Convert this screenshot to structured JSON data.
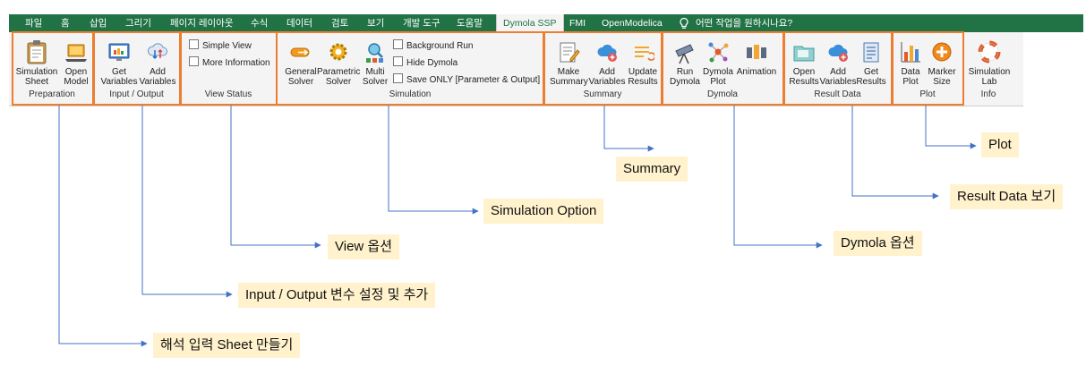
{
  "tabs": [
    "파일",
    "홈",
    "삽입",
    "그리기",
    "페이지 레이아웃",
    "수식",
    "데이터",
    "검토",
    "보기",
    "개발 도구",
    "도움말",
    "Dymola SSP",
    "FMI",
    "OpenModelica",
    "어떤 작업을 원하시나요?"
  ],
  "ribbon": {
    "preparation": {
      "label": "Preparation",
      "simulation_sheet": "Simulation\nSheet",
      "open_model": "Open\nModel"
    },
    "io": {
      "label": "Input / Output",
      "get_variables": "Get\nVariables",
      "add_variables": "Add\nVariables"
    },
    "view_status": {
      "label": "View Status",
      "simple_view": "Simple View",
      "more_information": "More Information"
    },
    "simulation": {
      "label": "Simulation",
      "general_solver": "General\nSolver",
      "parametric_solver": "Parametric\nSolver",
      "multi_solver": "Multi\nSolver",
      "background_run": "Background Run",
      "hide_dymola": "Hide Dymola",
      "save_only": "Save ONLY [Parameter & Output]"
    },
    "summary": {
      "label": "Summary",
      "make_summary": "Make\nSummary",
      "add_variables": "Add\nVariables",
      "update_results": "Update\nResults"
    },
    "dymola": {
      "label": "Dymola",
      "run_dymola": "Run\nDymola",
      "dymola_plot": "Dymola\nPlot",
      "animation": "Animation"
    },
    "result_data": {
      "label": "Result Data",
      "open_results": "Open\nResults",
      "add_variables": "Add\nVariables",
      "get_results": "Get\nResults"
    },
    "plot": {
      "label": "Plot",
      "data_plot": "Data\nPlot",
      "marker_size": "Marker\nSize"
    },
    "info": {
      "label": "Info",
      "simulation_lab": "Simulation\nLab"
    }
  },
  "callouts": {
    "plot": "Plot",
    "summary": "Summary",
    "result_data": "Result Data 보기",
    "simulation_option": "Simulation Option",
    "dymola_option": "Dymola 옵션",
    "view_option": "View 옵션",
    "io_option": "Input / Output 변수 설정 및 추가",
    "sheet": "해석 입력 Sheet 만들기"
  },
  "colors": {
    "excel_green": "#217346",
    "highlight": "#ed7d31",
    "callout_bg": "#fff2cc",
    "arrow": "#4472c4"
  }
}
